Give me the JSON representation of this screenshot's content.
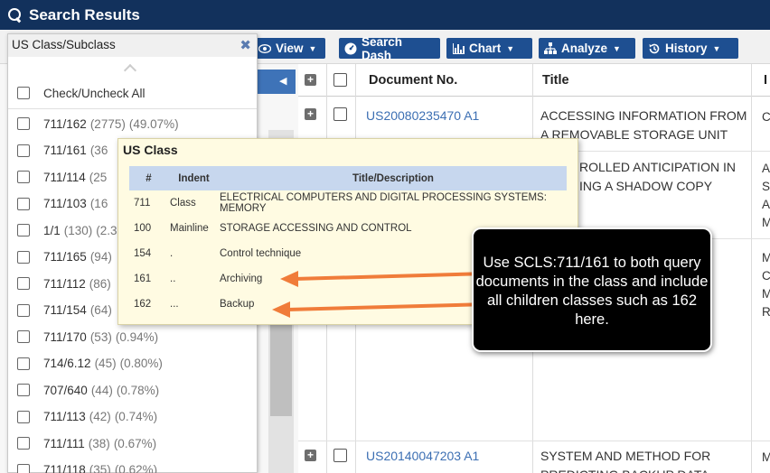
{
  "header": {
    "title": "Search Results",
    "icon": "search-icon"
  },
  "toolbar": {
    "view": "View",
    "search_dash": "Search Dash",
    "chart": "Chart",
    "analyze": "Analyze",
    "history": "History"
  },
  "facet": {
    "title": "US Class/Subclass",
    "check_all": "Check/Uncheck All",
    "items": [
      {
        "label": "711/162",
        "count": "(2775)",
        "pct": "(49.07%)"
      },
      {
        "label": "711/161",
        "count": "(36",
        "pct": ""
      },
      {
        "label": "711/114",
        "count": "(25",
        "pct": ""
      },
      {
        "label": "711/103",
        "count": "(16",
        "pct": ""
      },
      {
        "label": "1/1",
        "count": "(130)",
        "pct": "(2.3"
      },
      {
        "label": "711/165",
        "count": "(94)",
        "pct": ""
      },
      {
        "label": "711/112",
        "count": "(86)",
        "pct": ""
      },
      {
        "label": "711/154",
        "count": "(64)",
        "pct": ""
      },
      {
        "label": "711/170",
        "count": "(53)",
        "pct": "(0.94%)"
      },
      {
        "label": "714/6.12",
        "count": "(45)",
        "pct": "(0.80%)"
      },
      {
        "label": "707/640",
        "count": "(44)",
        "pct": "(0.78%)"
      },
      {
        "label": "711/113",
        "count": "(42)",
        "pct": "(0.74%)"
      },
      {
        "label": "711/111",
        "count": "(38)",
        "pct": "(0.67%)"
      },
      {
        "label": "711/118",
        "count": "(35)",
        "pct": "(0.62%)"
      }
    ]
  },
  "table": {
    "headers": {
      "doc_no": "Document No.",
      "title": "Title",
      "last": "I"
    },
    "rows": [
      {
        "doc_no": "US20080235470 A1",
        "title": "ACCESSING INFORMATION FROM A REMOVABLE STORAGE UNIT",
        "last": "C"
      },
      {
        "doc_no": "",
        "title": "ROLLED ANTICIPATION IN ING A SHADOW COPY",
        "last": "A\nS\nA\nM"
      },
      {
        "doc_no": "",
        "title": "",
        "last": "M\nC\nM\nR"
      },
      {
        "doc_no": "US20140047203 A1",
        "title": "SYSTEM AND METHOD FOR PREDICTING BACKUP DATA",
        "last": "M"
      }
    ]
  },
  "us_class": {
    "title": "US Class",
    "headers": [
      "#",
      "Indent",
      "Title/Description"
    ],
    "rows": [
      {
        "num": "711",
        "indent": "Class",
        "desc": "ELECTRICAL COMPUTERS AND DIGITAL PROCESSING SYSTEMS: MEMORY"
      },
      {
        "num": "100",
        "indent": "Mainline",
        "desc": "STORAGE ACCESSING AND CONTROL"
      },
      {
        "num": "154",
        "indent": ".",
        "desc": "Control technique"
      },
      {
        "num": "161",
        "indent": "..",
        "desc": "Archiving"
      },
      {
        "num": "162",
        "indent": "...",
        "desc": "Backup"
      }
    ]
  },
  "callout": {
    "text": "Use SCLS:711/161 to both query documents in the class and include all children classes such as 162 here."
  },
  "colors": {
    "header_bg": "#12315c",
    "button_bg": "#1e4f91",
    "link": "#3c6fb3",
    "arrow": "#f07c3a"
  }
}
